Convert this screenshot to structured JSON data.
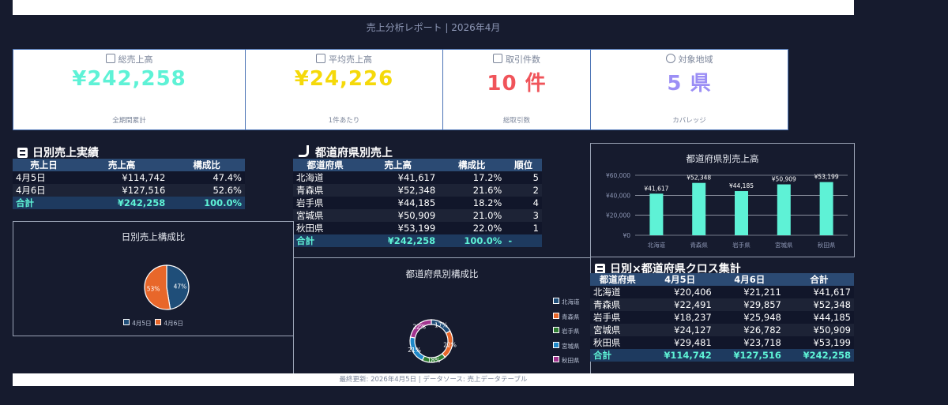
{
  "header": {
    "subtitle": "売上分析レポート | 2026年4月"
  },
  "kpis": [
    {
      "label": "総売上高",
      "value": "¥242,258",
      "sub": "全期間累計",
      "color": "#5ef2d6",
      "icon": "money-bag-icon"
    },
    {
      "label": "平均売上高",
      "value": "¥24,226",
      "sub": "1件あたり",
      "color": "#f5d90a",
      "icon": "chart-icon"
    },
    {
      "label": "取引件数",
      "value": "10 件",
      "sub": "総取引数",
      "color": "#f0545a",
      "icon": "clipboard-icon"
    },
    {
      "label": "対象地域",
      "value": "5 県",
      "sub": "カバレッジ",
      "color": "#9b8ef5",
      "icon": "map-icon"
    }
  ],
  "daily": {
    "title": "日別売上実績",
    "headers": [
      "売上日",
      "売上高",
      "構成比"
    ],
    "rows": [
      [
        "4月5日",
        "¥114,742",
        "47.4%"
      ],
      [
        "4月6日",
        "¥127,516",
        "52.6%"
      ]
    ],
    "total": [
      "合計",
      "¥242,258",
      "100.0%"
    ]
  },
  "pref": {
    "title": "都道府県別売上",
    "headers": [
      "都道府県",
      "売上高",
      "構成比",
      "順位"
    ],
    "rows": [
      [
        "北海道",
        "¥41,617",
        "17.2%",
        "5"
      ],
      [
        "青森県",
        "¥52,348",
        "21.6%",
        "2"
      ],
      [
        "岩手県",
        "¥44,185",
        "18.2%",
        "4"
      ],
      [
        "宮城県",
        "¥50,909",
        "21.0%",
        "3"
      ],
      [
        "秋田県",
        "¥53,199",
        "22.0%",
        "1"
      ]
    ],
    "total": [
      "合計",
      "¥242,258",
      "100.0%",
      "-"
    ]
  },
  "cross": {
    "title": "日別×都道府県クロス集計",
    "headers": [
      "都道府県",
      "4月5日",
      "4月6日",
      "合計"
    ],
    "rows": [
      [
        "北海道",
        "¥20,406",
        "¥21,211",
        "¥41,617"
      ],
      [
        "青森県",
        "¥22,491",
        "¥29,857",
        "¥52,348"
      ],
      [
        "岩手県",
        "¥18,237",
        "¥25,948",
        "¥44,185"
      ],
      [
        "宮城県",
        "¥24,127",
        "¥26,782",
        "¥50,909"
      ],
      [
        "秋田県",
        "¥29,481",
        "¥23,718",
        "¥53,199"
      ]
    ],
    "total": [
      "合計",
      "¥114,742",
      "¥127,516",
      "¥242,258"
    ]
  },
  "chart_data": [
    {
      "type": "bar",
      "title": "都道府県別売上高",
      "categories": [
        "北海道",
        "青森県",
        "岩手県",
        "宮城県",
        "秋田県"
      ],
      "values": [
        41617,
        52348,
        44185,
        50909,
        53199
      ],
      "data_labels": [
        "¥41,617",
        "¥52,348",
        "¥44,185",
        "¥50,909",
        "¥53,199"
      ],
      "ylim": [
        0,
        60000
      ],
      "yticks": [
        0,
        20000,
        40000,
        60000
      ],
      "ytick_labels": [
        "¥0",
        "¥20,000",
        "¥40,000",
        "¥60,000"
      ],
      "grid": true,
      "color": "#5ef2d6"
    },
    {
      "type": "pie",
      "title": "日別売上構成比",
      "labels": [
        "4月5日",
        "4月6日"
      ],
      "values": [
        47.4,
        52.6
      ],
      "data_labels": [
        "47%",
        "53%"
      ],
      "colors": [
        "#1f4e79",
        "#e8672a"
      ],
      "legend": "bottom"
    },
    {
      "type": "pie",
      "title": "都道府県別構成比",
      "labels": [
        "北海道",
        "青森県",
        "岩手県",
        "宮城県",
        "秋田県"
      ],
      "values": [
        17.2,
        21.6,
        18.2,
        21.0,
        22.0
      ],
      "data_labels": [
        "17%",
        "22%",
        "18%",
        "21%",
        "22%"
      ],
      "colors": [
        "#1f4e79",
        "#e8672a",
        "#2e7d32",
        "#1e88c8",
        "#a2348f"
      ],
      "legend": "right"
    }
  ],
  "footer": {
    "text": "最終更新: 2026年4月5日 | データソース: 売上データテーブル"
  }
}
